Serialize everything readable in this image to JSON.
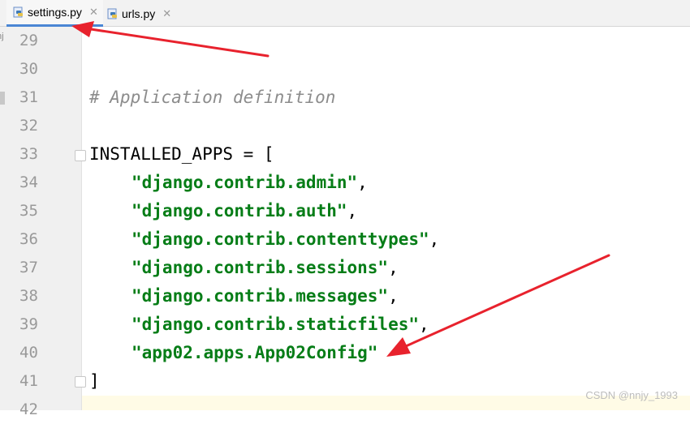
{
  "tabs": [
    {
      "label": "settings.py",
      "active": true,
      "icon": "python-file-icon"
    },
    {
      "label": "urls.py",
      "active": false,
      "icon": "python-file-icon"
    }
  ],
  "side_fragment": "nj",
  "lines": [
    {
      "number": "29",
      "text": ""
    },
    {
      "number": "30",
      "text": ""
    },
    {
      "number": "31",
      "text": "# Application definition"
    },
    {
      "number": "32",
      "text": ""
    },
    {
      "number": "33",
      "text": "INSTALLED_APPS = ["
    },
    {
      "number": "34",
      "text": "\"django.contrib.admin\""
    },
    {
      "number": "35",
      "text": "\"django.contrib.auth\""
    },
    {
      "number": "36",
      "text": "\"django.contrib.contenttypes\""
    },
    {
      "number": "37",
      "text": "\"django.contrib.sessions\""
    },
    {
      "number": "38",
      "text": "\"django.contrib.messages\""
    },
    {
      "number": "39",
      "text": "\"django.contrib.staticfiles\""
    },
    {
      "number": "40",
      "text": "\"app02.apps.App02Config\""
    },
    {
      "number": "41",
      "text": "]"
    },
    {
      "number": "42",
      "text": ""
    }
  ],
  "punct": {
    "comma": ","
  },
  "watermark": "CSDN @nnjy_1993",
  "colors": {
    "string": "#067d17",
    "comment": "#8c8c8c",
    "arrow": "#e8222d",
    "tab_underline": "#4a86d4"
  }
}
